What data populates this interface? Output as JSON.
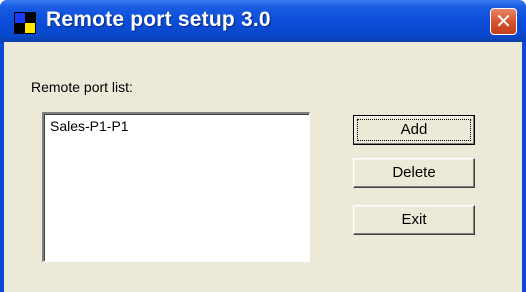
{
  "window": {
    "title": "Remote port setup 3.0",
    "close_glyph": "✕",
    "icon": "app-icon"
  },
  "label": "Remote port list:",
  "list": {
    "items": [
      "Sales-P1-P1"
    ]
  },
  "buttons": {
    "add": "Add",
    "delete": "Delete",
    "exit": "Exit"
  },
  "colors": {
    "titlebar": "#0b4bd8",
    "client_bg": "#ece9d8",
    "close_button": "#d8532f"
  }
}
